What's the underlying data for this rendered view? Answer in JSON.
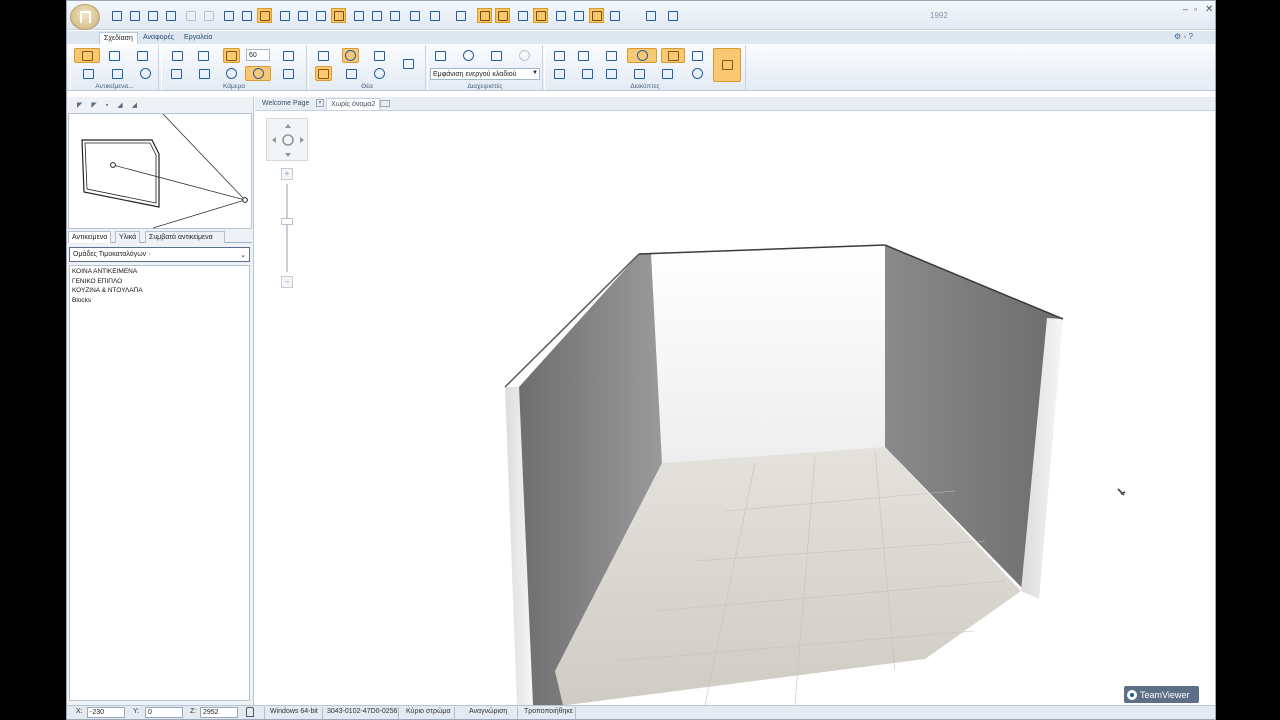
{
  "window": {
    "title": "1992"
  },
  "ribbon_tabs": [
    "Σχεδίαση",
    "Αναφορές",
    "Εργαλεία"
  ],
  "ribbon_groups": {
    "objects": "Αντικείμενα...",
    "camera": "Κάμερα",
    "view": "Θέα",
    "managers": "Διαχειριστές",
    "cutters": "Διακόπτες"
  },
  "camera_angle": "60",
  "layer_combo": "Εμφάνιση ενεργού κλαδιού",
  "doc_tabs": [
    "Welcome Page",
    "Χωρίς όνομα2"
  ],
  "panel_tabs": [
    "Αντικείμενα",
    "Υλικά",
    "Συμβατά αντικείμενα"
  ],
  "catalog_select": "Ομάδες Τιμοκαταλόγων",
  "catalog_items": [
    "ΚΟΙΝΑ ΑΝΤΙΚΕΙΜΕΝΑ",
    "ΓΕΝΙΚΟ ΕΠΙΠΛΟ",
    "ΚΟΥΖΙΝΑ & ΝΤΟΥΛΑΠΑ",
    "Blocks"
  ],
  "status": {
    "x_label": "X:",
    "x_value": "-230",
    "y_label": "Y:",
    "y_value": "0",
    "z_label": "Z:",
    "z_value": "2952",
    "platform": "Windows 64-bit",
    "build": "3043-0102-47D0-0256",
    "layer": "Κύριο στρώμα",
    "mode": "Αναγνώριση",
    "state": "Τροποποιήθηκε"
  },
  "overlay": {
    "teamviewer": "TeamViewer"
  },
  "icons": [
    "home-icon",
    "new-icon",
    "open-icon",
    "save-icon",
    "print-icon",
    "undo-icon",
    "redo-icon",
    "camera-icon",
    "eye-icon",
    "zoom-icon",
    "grid-icon",
    "lock-icon",
    "chevron-down-icon",
    "pan-icon",
    "plus-icon",
    "minus-icon"
  ],
  "colors": {
    "highlight": "#f8c66b",
    "ribbon_icon": "#1f5ea8",
    "wall": "#8b8b8b",
    "floor": "#d9d7d0"
  }
}
